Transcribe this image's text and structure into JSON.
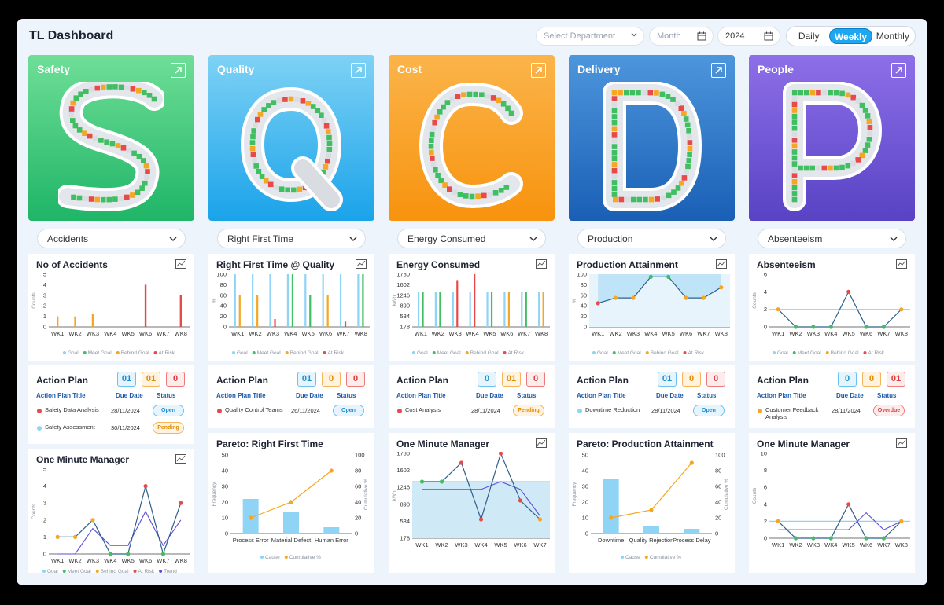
{
  "app": {
    "title": "TL Dashboard"
  },
  "filters": {
    "department_placeholder": "Select Department",
    "month_placeholder": "Month",
    "year": "2024",
    "views": [
      "Daily",
      "Weekly",
      "Monthly"
    ],
    "active_view": "Weekly"
  },
  "colors": {
    "goal": "#8fd3f5",
    "meet": "#3fbf62",
    "behind": "#f5a623",
    "risk": "#e84a4a",
    "trend": "#5b4fd6"
  },
  "legend": {
    "goal": "Goal",
    "meet": "Meet Goal",
    "behind": "Behind Goal",
    "risk": "At Risk",
    "trend": "Trend",
    "cause": "Cause",
    "cumulative": "Cumulative %"
  },
  "action_headers": {
    "title": "Action Plan Title",
    "due": "Due Date",
    "status": "Status"
  },
  "columns": [
    {
      "title": "Safety",
      "letter": "S",
      "gradient": [
        "#6fde97",
        "#1fb567"
      ],
      "dropdown": "Accidents",
      "kpi": {
        "title": "No of Accidents",
        "ylabel": "Counts",
        "yticks": [
          "5",
          "4",
          "3",
          "2",
          "1",
          "0"
        ]
      },
      "action": {
        "title": "Action Plan",
        "counts": [
          "01",
          "01",
          "0"
        ],
        "items": [
          {
            "title": "Safety Data Analysis",
            "due": "28/11/2024",
            "status": "Open",
            "dot": "risk"
          },
          {
            "title": "Safety Assessment",
            "due": "30/11/2024",
            "status": "Pending",
            "dot": "goal"
          }
        ]
      },
      "bottom": {
        "title": "One Minute Manager",
        "ylabel": "Counts",
        "yticks": [
          "5",
          "4",
          "3",
          "2",
          "1",
          "0"
        ]
      }
    },
    {
      "title": "Quality",
      "letter": "Q",
      "gradient": [
        "#7ed2f5",
        "#1aa3ea"
      ],
      "dropdown": "Right First Time",
      "kpi": {
        "title": "Right First Time @ Quality",
        "ylabel": "%",
        "yticks": [
          "100",
          "80",
          "60",
          "40",
          "20",
          "0"
        ]
      },
      "action": {
        "title": "Action Plan",
        "counts": [
          "01",
          "0",
          "0"
        ],
        "items": [
          {
            "title": "Quality Control Teams",
            "due": "26/11/2024",
            "status": "Open",
            "dot": "risk"
          }
        ]
      },
      "bottom": {
        "title": "Pareto: Right First Time",
        "ylabel": "Frequency",
        "y2label": "Cumulative %",
        "yticks": [
          "50",
          "40",
          "30",
          "20",
          "10",
          "0"
        ],
        "y2ticks": [
          "100",
          "80",
          "60",
          "40",
          "20",
          "0"
        ]
      }
    },
    {
      "title": "Cost",
      "letter": "C",
      "gradient": [
        "#fbb44a",
        "#f7930e"
      ],
      "dropdown": "Energy Consumed",
      "kpi": {
        "title": "Energy Consumed",
        "ylabel": "kWh",
        "yticks": [
          "1780",
          "1602",
          "1246",
          "890",
          "534",
          "178"
        ]
      },
      "action": {
        "title": "Action Plan",
        "counts": [
          "0",
          "01",
          "0"
        ],
        "items": [
          {
            "title": "Cost Analysis",
            "due": "28/11/2024",
            "status": "Pending",
            "dot": "risk"
          }
        ]
      },
      "bottom": {
        "title": "One Minute Manager",
        "ylabel": "kWh",
        "yticks": [
          "1780",
          "1602",
          "1246",
          "890",
          "534",
          "178"
        ]
      }
    },
    {
      "title": "Delivery",
      "letter": "D",
      "gradient": [
        "#4d96dc",
        "#1a5fb5"
      ],
      "dropdown": "Production",
      "kpi": {
        "title": "Production Attainment",
        "ylabel": "%",
        "yticks": [
          "100",
          "80",
          "60",
          "40",
          "20",
          "0"
        ]
      },
      "action": {
        "title": "Action Plan",
        "counts": [
          "01",
          "0",
          "0"
        ],
        "items": [
          {
            "title": "Downtime Reduction",
            "due": "28/11/2024",
            "status": "Open",
            "dot": "goal"
          }
        ]
      },
      "bottom": {
        "title": "Pareto: Production Attainment",
        "ylabel": "Frequency",
        "y2label": "Cumulative %",
        "yticks": [
          "50",
          "40",
          "30",
          "20",
          "10",
          "0"
        ],
        "y2ticks": [
          "100",
          "80",
          "60",
          "40",
          "20",
          "0"
        ]
      }
    },
    {
      "title": "People",
      "letter": "P",
      "gradient": [
        "#8d6fe8",
        "#5843c4"
      ],
      "dropdown": "Absenteeism",
      "kpi": {
        "title": "Absenteeism",
        "ylabel": "Counts",
        "yticks": [
          "6",
          "4",
          "2",
          "0"
        ]
      },
      "action": {
        "title": "Action Plan",
        "counts": [
          "0",
          "0",
          "01"
        ],
        "items": [
          {
            "title": "Customer Feedback Analysis",
            "due": "28/11/2024",
            "status": "Overdue",
            "dot": "behind"
          }
        ]
      },
      "bottom": {
        "title": "One Minute Manager",
        "ylabel": "Counts",
        "yticks": [
          "10",
          "8",
          "6",
          "4",
          "2",
          "0"
        ]
      }
    }
  ],
  "chart_data": [
    {
      "type": "bar",
      "title": "No of Accidents",
      "ylabel": "Counts",
      "categories": [
        "WK1",
        "WK2",
        "WK3",
        "WK4",
        "WK5",
        "WK6",
        "WK7",
        "WK8"
      ],
      "ylim": [
        0,
        5
      ],
      "values": [
        1,
        1,
        1.2,
        0,
        0,
        4,
        0,
        3
      ],
      "status": [
        "behind",
        "behind",
        "behind",
        "meet",
        "meet",
        "risk",
        "meet",
        "risk"
      ]
    },
    {
      "type": "bar",
      "title": "Right First Time @ Quality",
      "ylabel": "%",
      "categories": [
        "WK1",
        "WK2",
        "WK3",
        "WK4",
        "WK5",
        "WK6",
        "WK7",
        "WK8"
      ],
      "ylim": [
        0,
        100
      ],
      "goal": [
        100,
        100,
        100,
        100,
        100,
        100,
        100,
        100
      ],
      "values": [
        60,
        60,
        15,
        100,
        60,
        60,
        10,
        100
      ],
      "status": [
        "behind",
        "behind",
        "risk",
        "meet",
        "meet",
        "behind",
        "risk",
        "meet"
      ]
    },
    {
      "type": "bar",
      "title": "Energy Consumed",
      "ylabel": "kWh",
      "categories": [
        "WK1",
        "WK2",
        "WK3",
        "WK4",
        "WK5",
        "WK6",
        "WK7",
        "WK8"
      ],
      "ylim": [
        178,
        1780
      ],
      "goal": [
        1246,
        1246,
        1246,
        1246,
        1246,
        1246,
        1246,
        1246
      ],
      "values": [
        1246,
        1246,
        1602,
        1780,
        1246,
        1246,
        1246,
        1246
      ],
      "status": [
        "meet",
        "meet",
        "risk",
        "risk",
        "meet",
        "behind",
        "meet",
        "behind"
      ]
    },
    {
      "type": "area",
      "title": "Production Attainment",
      "ylabel": "%",
      "categories": [
        "WK1",
        "WK2",
        "WK3",
        "WK4",
        "WK5",
        "WK6",
        "WK7",
        "WK8"
      ],
      "ylim": [
        0,
        100
      ],
      "goal": 90,
      "values": [
        45,
        55,
        55,
        95,
        95,
        55,
        55,
        75
      ],
      "status": [
        "risk",
        "behind",
        "behind",
        "meet",
        "meet",
        "behind",
        "behind",
        "behind"
      ]
    },
    {
      "type": "line",
      "title": "Absenteeism",
      "ylabel": "Counts",
      "categories": [
        "WK1",
        "WK2",
        "WK3",
        "WK4",
        "WK5",
        "WK6",
        "WK7",
        "WK8"
      ],
      "ylim": [
        0,
        6
      ],
      "goal": 2,
      "values": [
        2,
        0,
        0,
        0,
        4,
        0,
        0,
        2
      ],
      "status": [
        "behind",
        "meet",
        "meet",
        "meet",
        "risk",
        "meet",
        "meet",
        "behind"
      ]
    },
    {
      "type": "line",
      "title": "One Minute Manager",
      "ylabel": "Counts",
      "categories": [
        "WK1",
        "WK2",
        "WK3",
        "WK4",
        "WK5",
        "WK6",
        "WK7",
        "WK8"
      ],
      "ylim": [
        0,
        5
      ],
      "values": [
        1,
        1,
        2,
        0,
        0,
        4,
        0,
        3
      ],
      "trend": [
        0,
        0,
        1.5,
        0.5,
        0.5,
        2.5,
        0.5,
        2
      ],
      "status": [
        "behind",
        "behind",
        "behind",
        "meet",
        "meet",
        "risk",
        "meet",
        "risk"
      ]
    },
    {
      "type": "bar",
      "title": "Pareto: Right First Time",
      "categories": [
        "Process Error",
        "Material Defect",
        "Human Error"
      ],
      "ylim": [
        0,
        50
      ],
      "values": [
        22,
        14,
        4
      ],
      "cumulative": [
        20,
        40,
        80
      ]
    },
    {
      "type": "area",
      "title": "One Minute Manager",
      "ylabel": "kWh",
      "categories": [
        "WK1",
        "WK2",
        "WK3",
        "WK4",
        "WK5",
        "WK6",
        "WK7"
      ],
      "ylim": [
        178,
        1780
      ],
      "goal": 1246,
      "values": [
        1246,
        1246,
        1602,
        534,
        1780,
        890,
        534
      ],
      "trend": [
        1100,
        1100,
        1100,
        1100,
        1246,
        1100,
        600
      ],
      "status": [
        "meet",
        "meet",
        "risk",
        "risk",
        "risk",
        "risk",
        "behind"
      ]
    },
    {
      "type": "bar",
      "title": "Pareto: Production Attainment",
      "categories": [
        "Downtime",
        "Quality Rejection",
        "Process Delay"
      ],
      "ylim": [
        0,
        50
      ],
      "values": [
        35,
        5,
        3
      ],
      "cumulative": [
        20,
        30,
        90
      ]
    },
    {
      "type": "line",
      "title": "One Minute Manager",
      "ylabel": "Counts",
      "categories": [
        "WK1",
        "WK2",
        "WK3",
        "WK4",
        "WK5",
        "WK6",
        "WK7",
        "WK8"
      ],
      "ylim": [
        0,
        10
      ],
      "goal": 2,
      "values": [
        2,
        0,
        0,
        0,
        4,
        0,
        0,
        2
      ],
      "trend": [
        1,
        1,
        1,
        1,
        1,
        3,
        1,
        2
      ],
      "status": [
        "behind",
        "meet",
        "meet",
        "meet",
        "risk",
        "meet",
        "meet",
        "behind"
      ]
    }
  ]
}
